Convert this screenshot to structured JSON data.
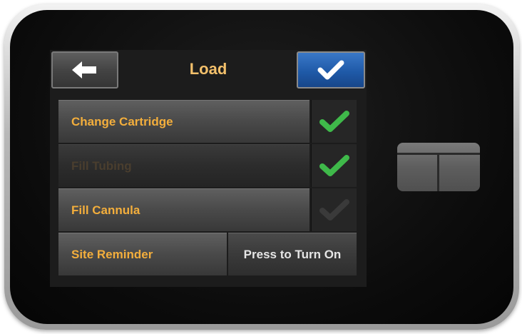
{
  "header": {
    "title": "Load",
    "back_icon": "arrow-left-icon",
    "confirm_icon": "checkmark-icon"
  },
  "rows": [
    {
      "label": "Change Cartridge",
      "status": "complete",
      "check_color": "#3fb94a"
    },
    {
      "label": "Fill Tubing",
      "status": "complete",
      "check_color": "#3fb94a",
      "disabled": true
    },
    {
      "label": "Fill Cannula",
      "status": "incomplete",
      "check_color": "#3a3a3a"
    }
  ],
  "site_reminder": {
    "label": "Site Reminder",
    "action_label": "Press to Turn On"
  },
  "device": {
    "side_button_icon": "t-logo-icon"
  },
  "colors": {
    "accent_orange": "#f3ae3c",
    "title_orange": "#f3c06b",
    "confirm_blue": "#1f5aa8",
    "check_green": "#3fb94a"
  }
}
